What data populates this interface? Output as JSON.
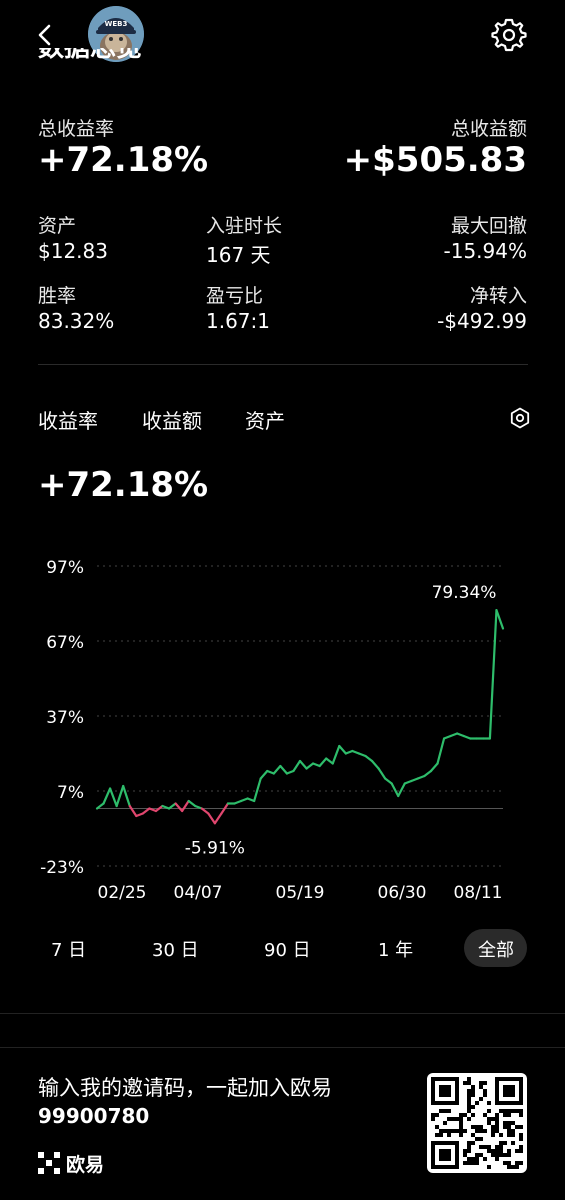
{
  "header": {
    "back_icon": "chevron-left-icon",
    "settings_icon": "gear-icon",
    "avatar_badge": "WEB3",
    "cut_title": "数据总览"
  },
  "summary": {
    "total_yield_label": "总收益率",
    "total_yield_value": "+72.18%",
    "total_profit_label": "总收益额",
    "total_profit_value": "+$505.83"
  },
  "stats": {
    "assets_label": "资产",
    "assets_value": "$12.83",
    "days_label": "入驻时长",
    "days_value": "167 天",
    "drawdown_label": "最大回撤",
    "drawdown_value": "-15.94%",
    "winrate_label": "胜率",
    "winrate_value": "83.32%",
    "pl_ratio_label": "盈亏比",
    "pl_ratio_value": "1.67:1",
    "net_in_label": "净转入",
    "net_in_value": "-$492.99"
  },
  "tabs": [
    "收益率",
    "收益额",
    "资产"
  ],
  "current_value": "+72.18%",
  "chart_data": {
    "type": "line",
    "y_ticks": [
      "97%",
      "67%",
      "37%",
      "7%",
      "-23%"
    ],
    "x_ticks": [
      "02/25",
      "04/07",
      "05/19",
      "06/30",
      "08/11"
    ],
    "ylim": [
      -23,
      97
    ],
    "max_label": "79.34%",
    "min_label": "-5.91%",
    "colors": {
      "positive": "#2ebd6b",
      "negative": "#e0466e",
      "grid": "#444444"
    },
    "series": [
      {
        "values": [
          0,
          2,
          8,
          1,
          9,
          1,
          -3,
          -2,
          0,
          -1,
          1,
          0,
          2,
          -1,
          3,
          1,
          0,
          -2,
          -5.91,
          -2,
          2,
          2,
          3,
          4,
          3,
          12,
          15,
          14,
          17,
          14,
          15,
          19,
          16,
          18,
          17,
          20,
          18,
          25,
          22,
          23,
          22,
          21,
          19,
          16,
          12,
          10,
          5,
          10,
          11,
          12,
          13,
          15,
          18,
          28,
          29,
          30,
          29,
          28,
          28,
          28,
          28,
          79.34,
          72
        ]
      }
    ]
  },
  "ranges": [
    "7 日",
    "30 日",
    "90 日",
    "1 年",
    "全部"
  ],
  "active_range": 4,
  "invite": {
    "text": "输入我的邀请码，一起加入欧易",
    "code": "99900780",
    "brand": "欧易"
  }
}
